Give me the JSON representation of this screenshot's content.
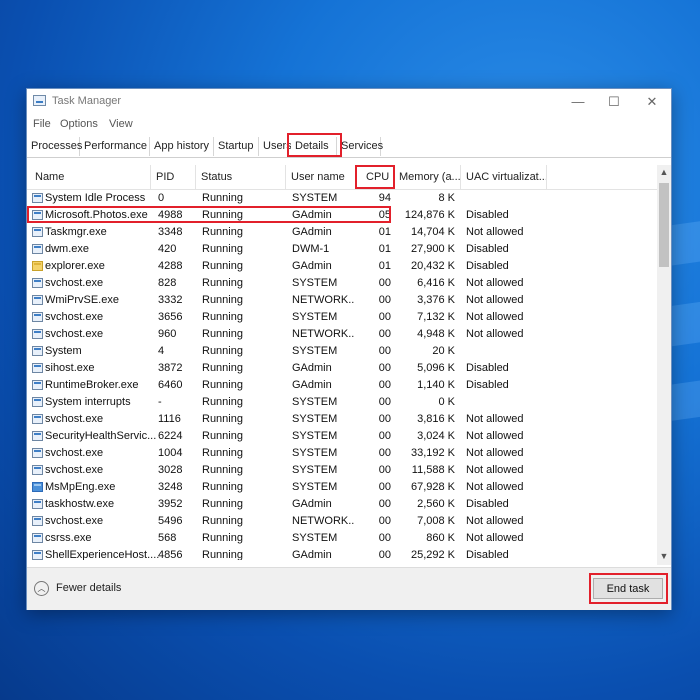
{
  "colors": {
    "highlight": "#e2202b",
    "desktop": "#1573d6",
    "window": "#ffffff"
  },
  "window": {
    "title": "Task Manager",
    "controls": {
      "minimize": "—",
      "maximize": "☐",
      "close": "✕"
    }
  },
  "menu": [
    "File",
    "Options",
    "View"
  ],
  "tabs": [
    "Processes",
    "Performance",
    "App history",
    "Startup",
    "Users",
    "Details",
    "Services"
  ],
  "active_tab": "Details",
  "columns": [
    "Name",
    "PID",
    "Status",
    "User name",
    "CPU",
    "Memory (a...",
    "UAC virtualizat..."
  ],
  "sort_indicator": "^",
  "processes": [
    {
      "name": "System Idle Process",
      "pid": "0",
      "status": "Running",
      "user": "SYSTEM",
      "cpu": "94",
      "mem": "8 K",
      "uac": "",
      "icon": "window-icon"
    },
    {
      "name": "Microsoft.Photos.exe",
      "pid": "4988",
      "status": "Running",
      "user": "GAdmin",
      "cpu": "05",
      "mem": "124,876 K",
      "uac": "Disabled",
      "icon": "window-icon"
    },
    {
      "name": "Taskmgr.exe",
      "pid": "3348",
      "status": "Running",
      "user": "GAdmin",
      "cpu": "01",
      "mem": "14,704 K",
      "uac": "Not allowed",
      "icon": "taskmgr-icon"
    },
    {
      "name": "dwm.exe",
      "pid": "420",
      "status": "Running",
      "user": "DWM-1",
      "cpu": "01",
      "mem": "27,900 K",
      "uac": "Disabled",
      "icon": "window-icon"
    },
    {
      "name": "explorer.exe",
      "pid": "4288",
      "status": "Running",
      "user": "GAdmin",
      "cpu": "01",
      "mem": "20,432 K",
      "uac": "Disabled",
      "icon": "folder-icon"
    },
    {
      "name": "svchost.exe",
      "pid": "828",
      "status": "Running",
      "user": "SYSTEM",
      "cpu": "00",
      "mem": "6,416 K",
      "uac": "Not allowed",
      "icon": "window-icon"
    },
    {
      "name": "WmiPrvSE.exe",
      "pid": "3332",
      "status": "Running",
      "user": "NETWORK...",
      "cpu": "00",
      "mem": "3,376 K",
      "uac": "Not allowed",
      "icon": "wmi-icon"
    },
    {
      "name": "svchost.exe",
      "pid": "3656",
      "status": "Running",
      "user": "SYSTEM",
      "cpu": "00",
      "mem": "7,132 K",
      "uac": "Not allowed",
      "icon": "window-icon"
    },
    {
      "name": "svchost.exe",
      "pid": "960",
      "status": "Running",
      "user": "NETWORK...",
      "cpu": "00",
      "mem": "4,948 K",
      "uac": "Not allowed",
      "icon": "window-icon"
    },
    {
      "name": "System",
      "pid": "4",
      "status": "Running",
      "user": "SYSTEM",
      "cpu": "00",
      "mem": "20 K",
      "uac": "",
      "icon": "window-icon"
    },
    {
      "name": "sihost.exe",
      "pid": "3872",
      "status": "Running",
      "user": "GAdmin",
      "cpu": "00",
      "mem": "5,096 K",
      "uac": "Disabled",
      "icon": "window-icon"
    },
    {
      "name": "RuntimeBroker.exe",
      "pid": "6460",
      "status": "Running",
      "user": "GAdmin",
      "cpu": "00",
      "mem": "1,140 K",
      "uac": "Disabled",
      "icon": "window-icon"
    },
    {
      "name": "System interrupts",
      "pid": "-",
      "status": "Running",
      "user": "SYSTEM",
      "cpu": "00",
      "mem": "0 K",
      "uac": "",
      "icon": "window-icon"
    },
    {
      "name": "svchost.exe",
      "pid": "1116",
      "status": "Running",
      "user": "SYSTEM",
      "cpu": "00",
      "mem": "3,816 K",
      "uac": "Not allowed",
      "icon": "window-icon"
    },
    {
      "name": "SecurityHealthServic...",
      "pid": "6224",
      "status": "Running",
      "user": "SYSTEM",
      "cpu": "00",
      "mem": "3,024 K",
      "uac": "Not allowed",
      "icon": "window-icon"
    },
    {
      "name": "svchost.exe",
      "pid": "1004",
      "status": "Running",
      "user": "SYSTEM",
      "cpu": "00",
      "mem": "33,192 K",
      "uac": "Not allowed",
      "icon": "window-icon"
    },
    {
      "name": "svchost.exe",
      "pid": "3028",
      "status": "Running",
      "user": "SYSTEM",
      "cpu": "00",
      "mem": "11,588 K",
      "uac": "Not allowed",
      "icon": "window-icon"
    },
    {
      "name": "MsMpEng.exe",
      "pid": "3248",
      "status": "Running",
      "user": "SYSTEM",
      "cpu": "00",
      "mem": "67,928 K",
      "uac": "Not allowed",
      "icon": "defender-icon"
    },
    {
      "name": "taskhostw.exe",
      "pid": "3952",
      "status": "Running",
      "user": "GAdmin",
      "cpu": "00",
      "mem": "2,560 K",
      "uac": "Disabled",
      "icon": "window-icon"
    },
    {
      "name": "svchost.exe",
      "pid": "5496",
      "status": "Running",
      "user": "NETWORK...",
      "cpu": "00",
      "mem": "7,008 K",
      "uac": "Not allowed",
      "icon": "window-icon"
    },
    {
      "name": "csrss.exe",
      "pid": "568",
      "status": "Running",
      "user": "SYSTEM",
      "cpu": "00",
      "mem": "860 K",
      "uac": "Not allowed",
      "icon": "window-icon"
    },
    {
      "name": "ShellExperienceHost....",
      "pid": "4856",
      "status": "Running",
      "user": "GAdmin",
      "cpu": "00",
      "mem": "25,292 K",
      "uac": "Disabled",
      "icon": "window-icon"
    }
  ],
  "footer": {
    "fewer_details": "Fewer details",
    "end_task": "End task"
  },
  "scrollbar": {
    "up": "▲",
    "down": "▼"
  }
}
